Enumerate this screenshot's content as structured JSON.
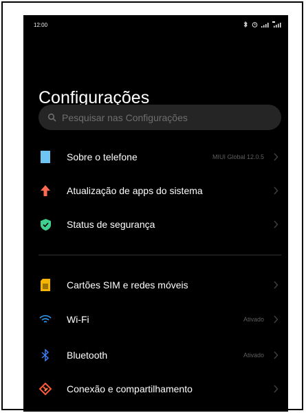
{
  "status": {
    "time": "12:00"
  },
  "page": {
    "title": "Configurações"
  },
  "search": {
    "placeholder": "Pesquisar nas Configurações"
  },
  "settings": [
    {
      "label": "Sobre o telefone",
      "value": "MIUI Global 12.0.5",
      "icon": "phone-icon",
      "color": "#6ec4f2"
    },
    {
      "label": "Atualização de apps do sistema",
      "value": "",
      "icon": "arrow-up-icon",
      "color": "#ff6b52"
    },
    {
      "label": "Status de segurança",
      "value": "",
      "icon": "shield-check-icon",
      "color": "#3fcf8e"
    },
    {
      "label": "Cartões SIM e redes móveis",
      "value": "",
      "icon": "sim-card-icon",
      "color": "#f7b500"
    },
    {
      "label": "Wi-Fi",
      "value": "Ativado",
      "icon": "wifi-icon",
      "color": "#2f9cf0"
    },
    {
      "label": "Bluetooth",
      "value": "Ativado",
      "icon": "bluetooth-icon",
      "color": "#3b84ff"
    },
    {
      "label": "Conexão e compartilhamento",
      "value": "",
      "icon": "connection-share-icon",
      "color": "#ff5a36"
    }
  ]
}
